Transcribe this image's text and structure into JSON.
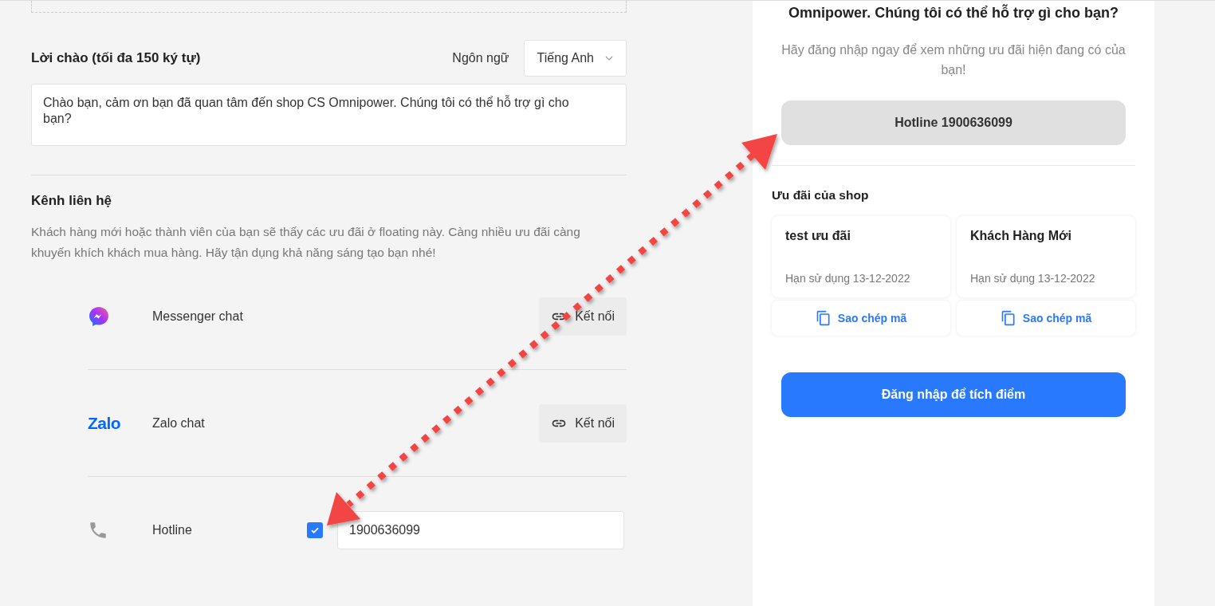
{
  "greeting": {
    "title": "Lời chào (tối đa 150 ký tự)",
    "language_label": "Ngôn ngữ",
    "language": "Tiếng Anh",
    "text": "Chào bạn, cảm ơn bạn đã quan tâm đến shop CS Omnipower. Chúng tôi có thể hỗ trợ gì cho bạn?"
  },
  "contact": {
    "title": "Kênh liên hệ",
    "description": "Khách hàng mới hoặc thành viên của bạn sẽ thấy các ưu đãi ở floating này. Càng nhiều ưu đãi càng khuyến khích khách mua hàng. Hãy tận dụng khả năng sáng tạo bạn nhé!",
    "channels": [
      {
        "kind": "messenger",
        "name": "Messenger chat",
        "button": "Kết nối"
      },
      {
        "kind": "zalo",
        "logo": "Zalo",
        "name": "Zalo chat",
        "button": "Kết nối"
      },
      {
        "kind": "hotline",
        "name": "Hotline",
        "checked": true,
        "value": "1900636099"
      }
    ]
  },
  "preview": {
    "title": "Omnipower. Chúng tôi có thể hỗ trợ gì cho bạn?",
    "subtitle": "Hãy đăng nhập ngay để xem những ưu đãi hiện đang có của bạn!",
    "hotline_button": "Hotline 1900636099",
    "offers_title": "Ưu đãi của shop",
    "offers": [
      {
        "name": "test ưu đãi",
        "expiry": "Hạn sử dụng 13-12-2022",
        "copy": "Sao chép mã"
      },
      {
        "name": "Khách Hàng Mới",
        "expiry": "Hạn sử dụng 13-12-2022",
        "copy": "Sao chép mã"
      }
    ],
    "login_button": "Đăng nhập để tích điểm"
  }
}
